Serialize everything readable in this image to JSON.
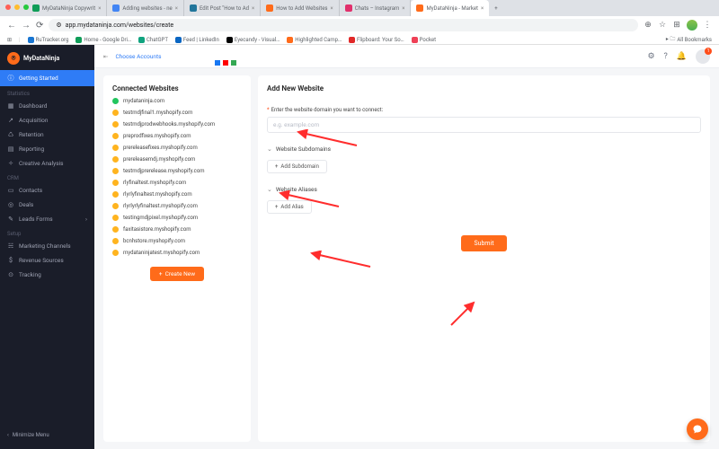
{
  "browser": {
    "tabs": [
      {
        "label": "MyDataNinja Copywrit",
        "fav": "#0f9d58"
      },
      {
        "label": "Adding websites - ne",
        "fav": "#4285f4"
      },
      {
        "label": "Edit Post \"How to Ad",
        "fav": "#21759b"
      },
      {
        "label": "How to Add Websites",
        "fav": "#ff6b1a"
      },
      {
        "label": "Chats – Instagram",
        "fav": "#e1306c"
      },
      {
        "label": "MyDataNinja - Market",
        "fav": "#ff6b1a",
        "active": true
      }
    ],
    "url": "app.mydataninja.com/websites/create",
    "bookmarks": [
      {
        "label": "RuTracker.org",
        "color": "#1976d2"
      },
      {
        "label": "Home - Google Dri…",
        "color": "#0f9d58"
      },
      {
        "label": "ChatGPT",
        "color": "#10a37f"
      },
      {
        "label": "Feed | LinkedIn",
        "color": "#0a66c2"
      },
      {
        "label": "Eyecandy - Visual…",
        "color": "#000"
      },
      {
        "label": "Highlighted Camp…",
        "color": "#ff6b1a"
      },
      {
        "label": "Flipboard: Your So…",
        "color": "#e12828"
      },
      {
        "label": "Pocket",
        "color": "#ef4056"
      }
    ],
    "all_bookmarks": "All Bookmarks"
  },
  "sidebar": {
    "brand": "MyDataNinja",
    "getting_started": "Getting Started",
    "sections": {
      "statistics": "Statistics",
      "crm": "CRM",
      "setup": "Setup"
    },
    "items": {
      "dashboard": "Dashboard",
      "acquisition": "Acquisition",
      "retention": "Retention",
      "reporting": "Reporting",
      "creative": "Creative Analysis",
      "contacts": "Contacts",
      "deals": "Deals",
      "leads": "Leads Forms",
      "marketing": "Marketing Channels",
      "revenue": "Revenue Sources",
      "tracking": "Tracking"
    },
    "minimize": "Minimize Menu"
  },
  "topbar": {
    "choose": "Choose Accounts",
    "notif_count": "1"
  },
  "connected": {
    "title": "Connected Websites",
    "sites": [
      {
        "name": "mydataninja.com",
        "status": "ok"
      },
      {
        "name": "testmdjfinal1.myshopify.com",
        "status": "warn"
      },
      {
        "name": "testmdjprodwebhooks.myshopify.com",
        "status": "warn"
      },
      {
        "name": "preprodfixes.myshopify.com",
        "status": "warn"
      },
      {
        "name": "prereleasefixes.myshopify.com",
        "status": "warn"
      },
      {
        "name": "prereleasemdj.myshopify.com",
        "status": "warn"
      },
      {
        "name": "testmdjprerelease.myshopify.com",
        "status": "warn"
      },
      {
        "name": "rlyfinaltest.myshopify.com",
        "status": "warn"
      },
      {
        "name": "rlyrlyfinaltest.myshopify.com",
        "status": "warn"
      },
      {
        "name": "rlyrlyrlyfinaltest.myshopify.com",
        "status": "warn"
      },
      {
        "name": "testingmdjpixel.myshopify.com",
        "status": "warn"
      },
      {
        "name": "faxitasistore.myshopify.com",
        "status": "warn"
      },
      {
        "name": "bcnhstore.myshopify.com",
        "status": "warn"
      },
      {
        "name": "mydataninjatest.myshopify.com",
        "status": "warn"
      }
    ],
    "create_new": "Create New"
  },
  "form": {
    "title": "Add New Website",
    "domain_label": "Enter the website domain you want to connect:",
    "domain_placeholder": "e.g. example.com",
    "subdomains": "Website Subdomains",
    "add_subdomain": "Add Subdomain",
    "aliases": "Website Aliases",
    "add_alias": "Add Alias",
    "submit": "Submit"
  }
}
